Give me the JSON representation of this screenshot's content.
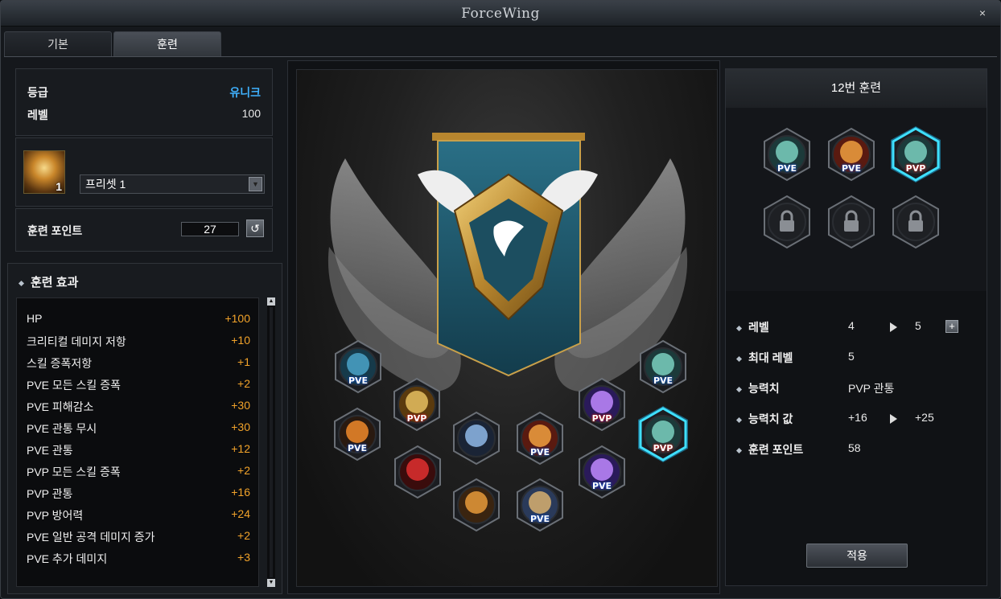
{
  "window": {
    "title": "ForceWing",
    "close_glyph": "×"
  },
  "tabs": [
    {
      "label": "기본",
      "active": false
    },
    {
      "label": "훈련",
      "active": true
    }
  ],
  "info": {
    "grade_label": "등급",
    "grade_value": "유니크",
    "grade_color": "#3fb2ff",
    "level_label": "레벨",
    "level_value": "100"
  },
  "preset": {
    "avatar_icon": "angel-wing-portrait-icon",
    "avatar_number": "1",
    "selected": "프리셋 1"
  },
  "training_points": {
    "label": "훈련 포인트",
    "value": "27"
  },
  "effects": {
    "title": "훈련 효과",
    "items": [
      {
        "name": "HP",
        "value": "+100"
      },
      {
        "name": "크리티컬 데미지 저항",
        "value": "+10"
      },
      {
        "name": "스킬 증폭저항",
        "value": "+1"
      },
      {
        "name": "PVE 모든 스킬 증폭",
        "value": "+2"
      },
      {
        "name": "PVE 피해감소",
        "value": "+30"
      },
      {
        "name": "PVE 관통 무시",
        "value": "+30"
      },
      {
        "name": "PVE 관통",
        "value": "+12"
      },
      {
        "name": "PVP 모든 스킬 증폭",
        "value": "+2"
      },
      {
        "name": "PVP 관통",
        "value": "+16"
      },
      {
        "name": "PVP 방어력",
        "value": "+24"
      },
      {
        "name": "PVE 일반 공격 데미지 증가",
        "value": "+2"
      },
      {
        "name": "PVE 추가 데미지",
        "value": "+3"
      }
    ]
  },
  "tree_nodes": [
    {
      "tag": "PVE",
      "icon": "crossed-swords-icon",
      "selected": false
    },
    {
      "tag": "PVP",
      "icon": "golden-shield-icon",
      "selected": false
    },
    {
      "tag": "PVE",
      "icon": "shadow-figure-icon",
      "selected": false
    },
    {
      "tag": "",
      "icon": "red-potion-icon",
      "selected": false
    },
    {
      "tag": "",
      "icon": "spirit-dancer-icon",
      "selected": false
    },
    {
      "tag": "PVE",
      "icon": "fist-icon",
      "selected": false
    },
    {
      "tag": "",
      "icon": "gauntlet-fist-icon",
      "selected": false
    },
    {
      "tag": "PVE",
      "icon": "armored-fist-icon",
      "selected": false
    },
    {
      "tag": "PVP",
      "icon": "lightning-claw-icon",
      "selected": false
    },
    {
      "tag": "PVE",
      "icon": "lightning-claw-icon",
      "selected": false
    },
    {
      "tag": "PVE",
      "icon": "green-orb-icon",
      "selected": false
    },
    {
      "tag": "PVP",
      "icon": "green-orb-icon",
      "selected": true
    }
  ],
  "detail": {
    "title": "12번 훈련",
    "slots": [
      {
        "tag": "PVE",
        "icon": "green-orb-icon",
        "locked": false,
        "selected": false
      },
      {
        "tag": "PVE",
        "icon": "fist-icon",
        "locked": false,
        "selected": false
      },
      {
        "tag": "PVP",
        "icon": "green-orb-icon",
        "locked": false,
        "selected": true
      },
      {
        "tag": "",
        "icon": "lock-icon",
        "locked": true,
        "selected": false
      },
      {
        "tag": "",
        "icon": "lock-icon",
        "locked": true,
        "selected": false
      },
      {
        "tag": "",
        "icon": "lock-icon",
        "locked": true,
        "selected": false
      }
    ],
    "level_label": "레벨",
    "level_from": "4",
    "level_to": "5",
    "max_level_label": "최대 레벨",
    "max_level": "5",
    "stat_label": "능력치",
    "stat_value": "PVP 관통",
    "stat_amount_label": "능력치 값",
    "stat_amount_from": "+16",
    "stat_amount_to": "+25",
    "points_label": "훈련 포인트",
    "points_value": "58",
    "apply_label": "적용"
  }
}
